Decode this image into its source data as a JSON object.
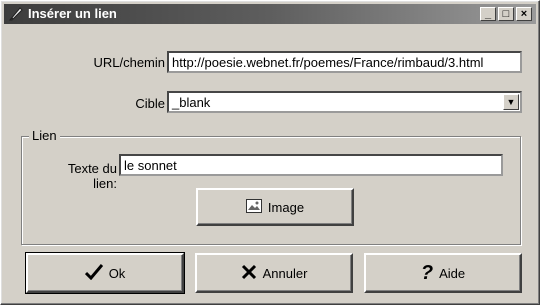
{
  "window": {
    "title": "Insérer un lien"
  },
  "title_buttons": {
    "minimize": "_",
    "maximize": "□",
    "close": "×"
  },
  "fields": {
    "url_label": "URL/chemin",
    "url_value": "http://poesie.webnet.fr/poemes/France/rimbaud/3.html",
    "target_label": "Cible",
    "target_value": "_blank"
  },
  "group": {
    "label": "Lien",
    "text_label_line1": "Texte du",
    "text_label_line2": "lien:",
    "text_value": "le sonnet",
    "image_button": "Image"
  },
  "buttons": {
    "ok": "Ok",
    "cancel": "Annuler",
    "help": "Aide"
  }
}
